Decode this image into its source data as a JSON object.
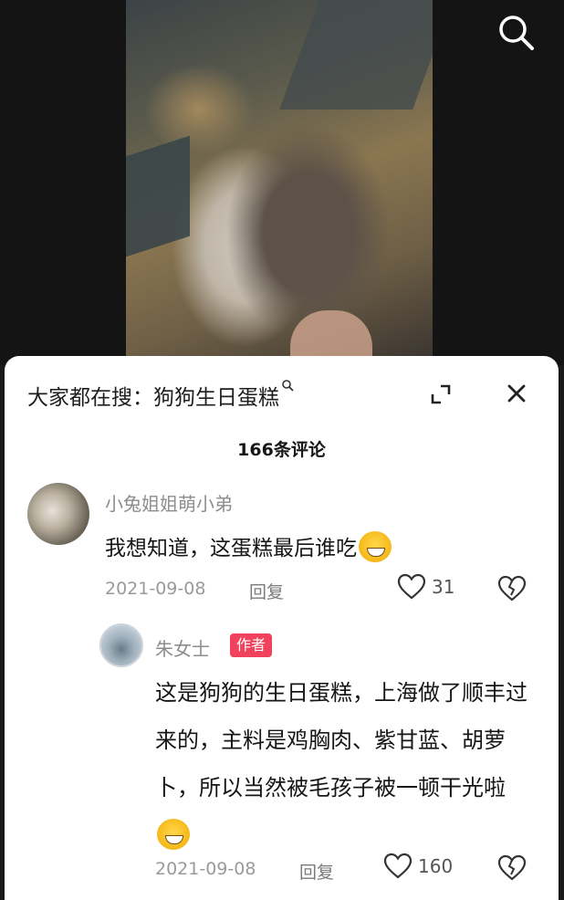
{
  "header": {
    "search_hint": "大家都在搜：狗狗生日蛋糕"
  },
  "comments_count": "166条评论",
  "comments": [
    {
      "username": "小兔姐姐萌小弟",
      "text": "我想知道，这蛋糕最后谁吃",
      "emoji": "laughing-crying-emoji",
      "date": "2021-09-08",
      "reply_label": "回复",
      "likes": "31"
    },
    {
      "username": "朱女士",
      "badge": "作者",
      "text": "这是狗狗的生日蛋糕，上海做了顺丰过来的，主料是鸡胸肉、紫甘蓝、胡萝卜，所以当然被毛孩子被一顿干光啦",
      "emoji": "grinning-emoji",
      "date": "2021-09-08",
      "reply_label": "回复",
      "likes": "160"
    }
  ],
  "icons": {
    "top_search": "search-icon",
    "expand": "expand-icon",
    "close": "close-icon",
    "like": "heart-icon",
    "dislike": "broken-heart-icon"
  },
  "colors": {
    "author_badge": "#f0425c",
    "sheet_background": "#ffffff",
    "video_background": "#141414"
  }
}
